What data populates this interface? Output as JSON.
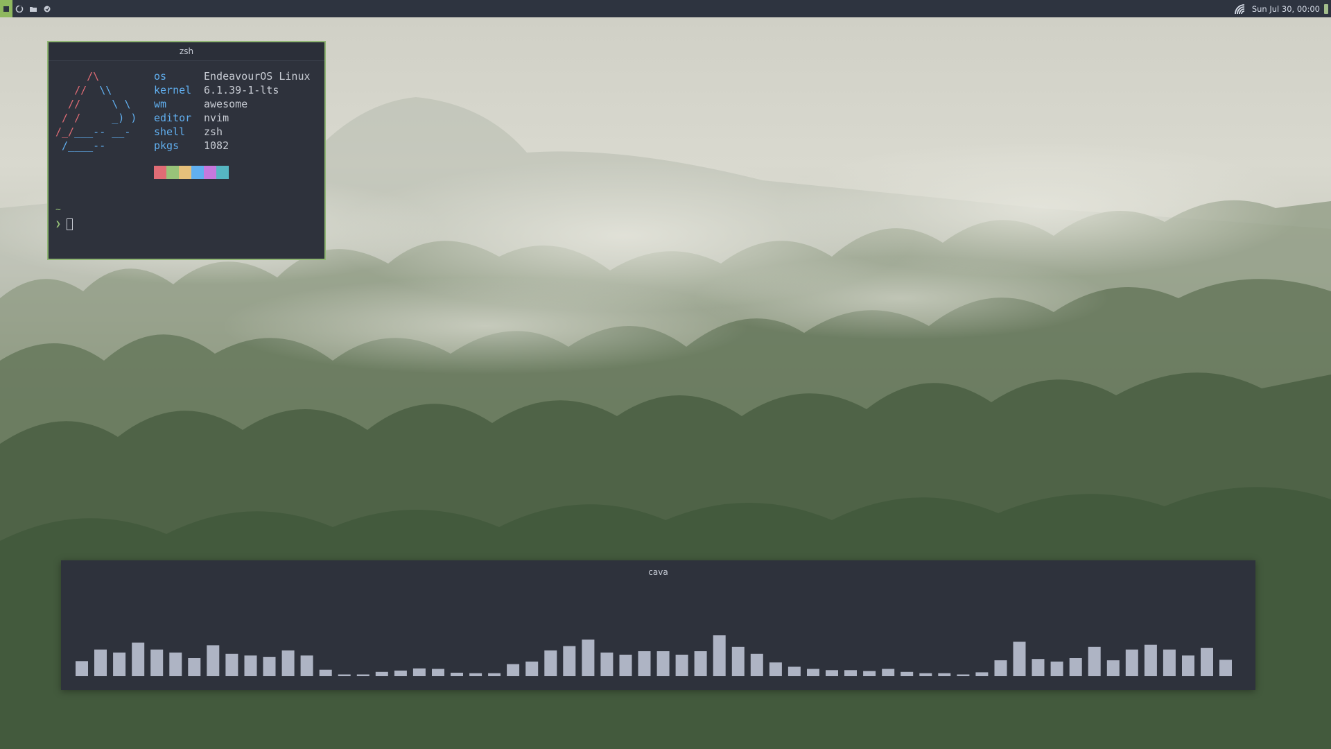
{
  "topbar": {
    "clock": "Sun Jul 30, 00:00",
    "launchers": [
      "terminal-icon",
      "folder-icon",
      "browser-icon"
    ],
    "wifi_icon": "wifi-icon",
    "battery_icon": "battery-icon"
  },
  "terminal": {
    "title": "zsh",
    "info": [
      {
        "key": "os",
        "value": "EndeavourOS Linux"
      },
      {
        "key": "kernel",
        "value": "6.1.39-1-lts"
      },
      {
        "key": "wm",
        "value": "awesome"
      },
      {
        "key": "editor",
        "value": "nvim"
      },
      {
        "key": "shell",
        "value": "zsh"
      },
      {
        "key": "pkgs",
        "value": "1082"
      }
    ],
    "swatches": [
      "#e06c75",
      "#98c379",
      "#e5c07b",
      "#61afef",
      "#c678dd",
      "#56b6c2"
    ],
    "prompt_dir": "~",
    "prompt_symbol": "❯"
  },
  "cava": {
    "title": "cava",
    "bar_color": "#aeb4c4",
    "levels": [
      0.35,
      0.62,
      0.55,
      0.78,
      0.62,
      0.55,
      0.42,
      0.72,
      0.52,
      0.48,
      0.45,
      0.6,
      0.48,
      0.15,
      0.04,
      0.04,
      0.1,
      0.13,
      0.18,
      0.17,
      0.08,
      0.07,
      0.07,
      0.28,
      0.34,
      0.6,
      0.7,
      0.85,
      0.55,
      0.5,
      0.58,
      0.58,
      0.5,
      0.58,
      0.95,
      0.68,
      0.52,
      0.32,
      0.22,
      0.17,
      0.14,
      0.14,
      0.12,
      0.17,
      0.1,
      0.07,
      0.07,
      0.04,
      0.09,
      0.37,
      0.8,
      0.4,
      0.34,
      0.42,
      0.68,
      0.37,
      0.62,
      0.73,
      0.62,
      0.48,
      0.66,
      0.38
    ]
  }
}
